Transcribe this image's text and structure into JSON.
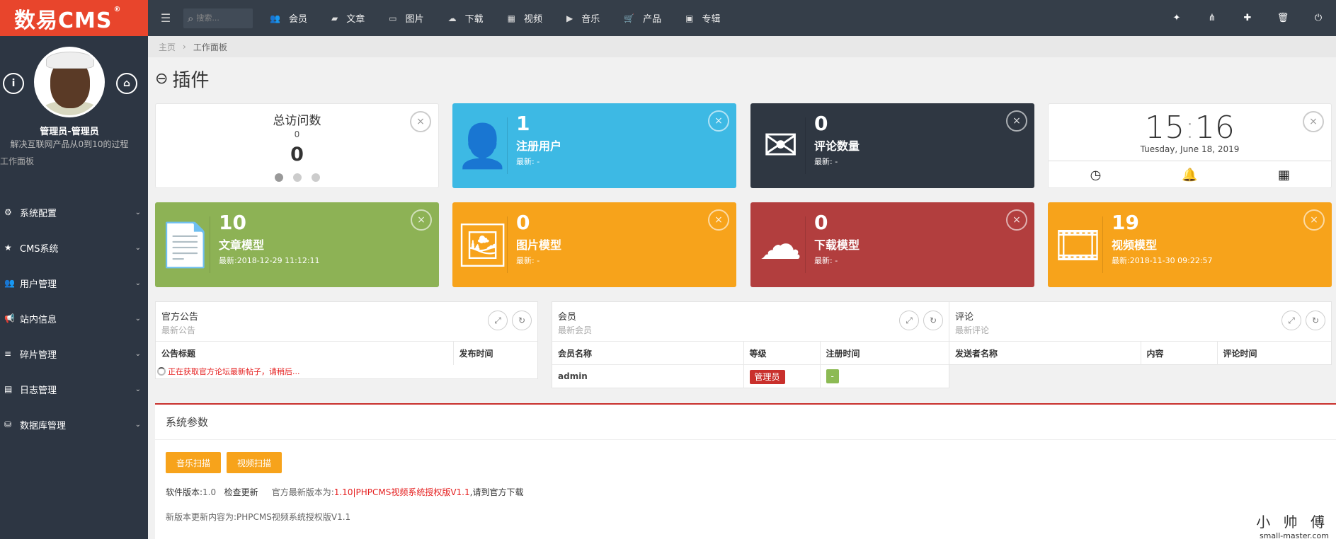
{
  "brand": {
    "logo": "数易CMS",
    "reg": "®"
  },
  "topnav": {
    "search_placeholder": "搜索...",
    "items": [
      {
        "label": "会员",
        "icon": "users-icon"
      },
      {
        "label": "文章",
        "icon": "book-icon"
      },
      {
        "label": "图片",
        "icon": "picture-icon"
      },
      {
        "label": "下载",
        "icon": "cloud-download-icon"
      },
      {
        "label": "视频",
        "icon": "film-icon"
      },
      {
        "label": "音乐",
        "icon": "play-square-icon"
      },
      {
        "label": "产品",
        "icon": "cart-icon"
      },
      {
        "label": "专辑",
        "icon": "grid-icon"
      }
    ],
    "right_icons": [
      "gift-icon",
      "sitemap-icon",
      "puzzle-icon",
      "trash-icon",
      "power-icon"
    ]
  },
  "sidebar": {
    "user_name": "管理员-管理员",
    "user_motto": "解决互联网产品从0到10的过程",
    "section": "工作面板",
    "items": [
      {
        "label": "系统配置",
        "icon": "cogs-icon"
      },
      {
        "label": "CMS系统",
        "icon": "star-icon"
      },
      {
        "label": "用户管理",
        "icon": "users-icon"
      },
      {
        "label": "站内信息",
        "icon": "bullhorn-icon"
      },
      {
        "label": "碎片管理",
        "icon": "bars-icon"
      },
      {
        "label": "日志管理",
        "icon": "log-icon"
      },
      {
        "label": "数据库管理",
        "icon": "database-icon"
      }
    ]
  },
  "breadcrumb": {
    "home": "主页",
    "sep": "›",
    "current": "工作面板"
  },
  "page": {
    "title": "插件"
  },
  "visits": {
    "title": "总访问数",
    "small": "0",
    "big": "0"
  },
  "tiles": {
    "users": {
      "num": "1",
      "title": "注册用户",
      "sub": "最新: -",
      "color": "#3db9e4"
    },
    "comments": {
      "num": "0",
      "title": "评论数量",
      "sub": "最新: -",
      "color": "#2f3742"
    },
    "article": {
      "num": "10",
      "title": "文章模型",
      "sub": "最新:2018-12-29 11:12:11",
      "color": "#8db255"
    },
    "image": {
      "num": "0",
      "title": "图片模型",
      "sub": "最新: -",
      "color": "#f7a31b"
    },
    "download": {
      "num": "0",
      "title": "下载模型",
      "sub": "最新: -",
      "color": "#b23e3e"
    },
    "video": {
      "num": "19",
      "title": "视频模型",
      "sub": "最新:2018-11-30 09:22:57",
      "color": "#f7a31b"
    }
  },
  "clock": {
    "hh": "15",
    "colon": ":",
    "mm": "16",
    "date": "Tuesday, June 18, 2019"
  },
  "notice": {
    "title": "官方公告",
    "subtitle": "最新公告",
    "col1": "公告标题",
    "col2": "发布时间",
    "loading": "正在获取官方论坛最新帖子，请稍后..."
  },
  "members": {
    "title": "会员",
    "subtitle": "最新会员",
    "col1": "会员名称",
    "col2": "等级",
    "col3": "注册时间",
    "row": {
      "name": "admin",
      "level": "管理员",
      "time": "-"
    }
  },
  "reviews": {
    "title": "评论",
    "subtitle": "最新评论",
    "col1": "发送者名称",
    "col2": "内容",
    "col3": "评论时间"
  },
  "sysinfo": {
    "title": "系统参数",
    "btn_music": "音乐扫描",
    "btn_video": "视频扫描",
    "ver_label": "软件版本:",
    "ver_value": "1.0",
    "check_update": "检查更新",
    "latest_label": "官方最新版本为:",
    "latest_value": "1.10|PHPCMS视频系统授权版V1.1",
    "go_download": ",请到官方下载",
    "update_content": "新版本更新内容为:PHPCMS视频系统授权版V1.1"
  },
  "watermark": {
    "line1": "小 帅 傅",
    "line2": "small-master.com"
  }
}
